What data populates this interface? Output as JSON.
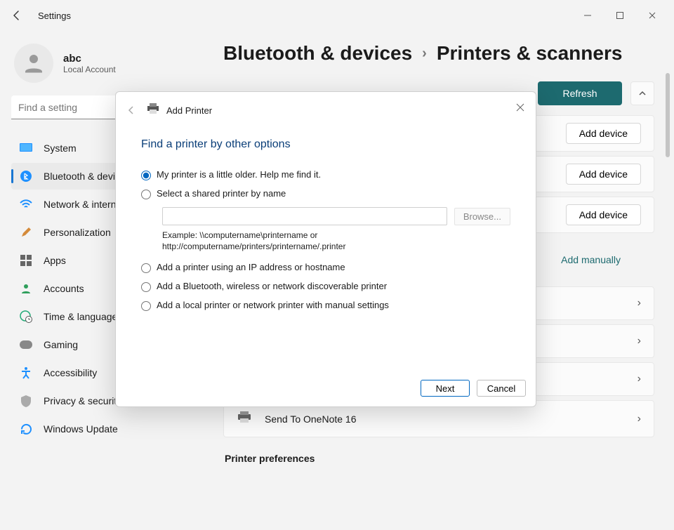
{
  "titlebar": {
    "title": "Settings"
  },
  "user": {
    "name": "abc",
    "type": "Local Account"
  },
  "search": {
    "placeholder": "Find a setting"
  },
  "nav": [
    {
      "label": "System",
      "icon": "system"
    },
    {
      "label": "Bluetooth & devices",
      "icon": "bluetooth",
      "active": true
    },
    {
      "label": "Network & internet",
      "icon": "wifi"
    },
    {
      "label": "Personalization",
      "icon": "brush"
    },
    {
      "label": "Apps",
      "icon": "apps"
    },
    {
      "label": "Accounts",
      "icon": "person"
    },
    {
      "label": "Time & language",
      "icon": "globe-clock"
    },
    {
      "label": "Gaming",
      "icon": "game"
    },
    {
      "label": "Accessibility",
      "icon": "accessibility"
    },
    {
      "label": "Privacy & security",
      "icon": "shield"
    },
    {
      "label": "Windows Update",
      "icon": "update"
    }
  ],
  "breadcrumb": {
    "parent": "Bluetooth & devices",
    "current": "Printers & scanners"
  },
  "actions": {
    "refresh": "Refresh",
    "add_device": "Add device",
    "add_manually": "Add manually"
  },
  "printers": [
    {
      "name": "Send To OneNote 16"
    }
  ],
  "preferences_heading": "Printer preferences",
  "dialog": {
    "title": "Add Printer",
    "heading": "Find a printer by other options",
    "options": {
      "older": "My printer is a little older. Help me find it.",
      "shared": "Select a shared printer by name",
      "browse": "Browse...",
      "example": "Example: \\\\computername\\printername or http://computername/printers/printername/.printer",
      "ip": "Add a printer using an IP address or hostname",
      "bt": "Add a Bluetooth, wireless or network discoverable printer",
      "local": "Add a local printer or network printer with manual settings"
    },
    "buttons": {
      "next": "Next",
      "cancel": "Cancel"
    }
  }
}
